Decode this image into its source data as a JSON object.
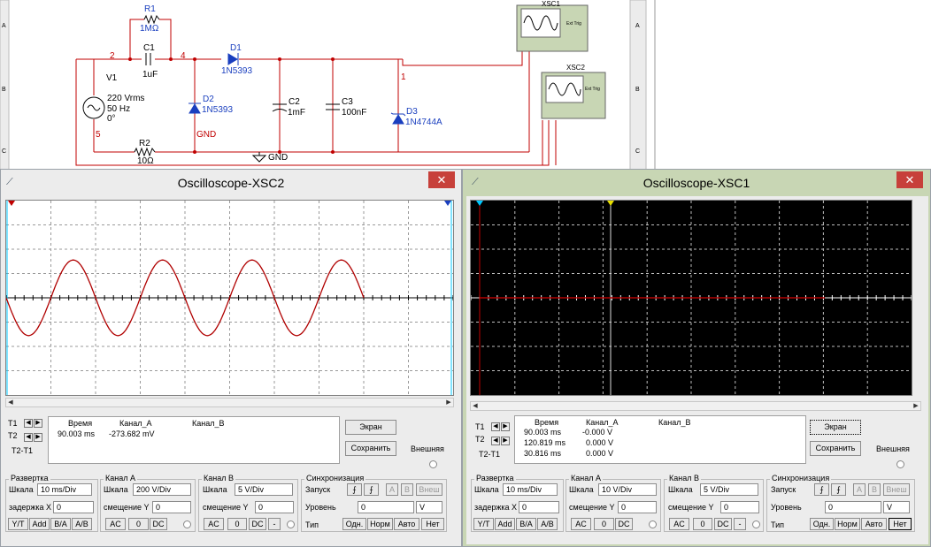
{
  "schematic": {
    "row_labels": [
      "A",
      "B",
      "C"
    ],
    "r1": {
      "name": "R1",
      "value": "1MΩ"
    },
    "c1": {
      "name": "C1",
      "value": "1uF"
    },
    "d1": {
      "name": "D1",
      "value": "1N5393"
    },
    "v1": {
      "name": "V1",
      "line1": "220 Vrms",
      "line2": "50 Hz",
      "line3": "0°"
    },
    "d2": {
      "name": "D2",
      "value": "1N5393"
    },
    "c2": {
      "name": "C2",
      "value": "1mF"
    },
    "c3": {
      "name": "C3",
      "value": "100nF"
    },
    "d3": {
      "name": "D3",
      "value": "1N4744A"
    },
    "r2": {
      "name": "R2",
      "value": "10Ω"
    },
    "gnd1": "GND",
    "gnd2": "GND",
    "nodes": {
      "n2": "2",
      "n4": "4",
      "n1": "1",
      "n5": "5"
    },
    "xsc1": {
      "name": "XSC1",
      "ext": "Ext Trig"
    },
    "xsc2": {
      "name": "XSC2",
      "ext": "Ext Trig"
    }
  },
  "xsc2_window": {
    "title": "Oscilloscope-XSC2",
    "close": "✕",
    "readout": {
      "col_time": "Время",
      "col_a": "Канал_A",
      "col_b": "Канал_B",
      "rows": [
        {
          "t": "T1"
        },
        {
          "t": "T2"
        },
        {
          "t": "T2-T1"
        }
      ],
      "values": [
        {
          "time": "90.003 ms",
          "a": "-273.682 mV",
          "b": ""
        }
      ]
    },
    "btn_screen": "Экран",
    "btn_save": "Сохранить",
    "external": "Внешняя",
    "timebase": {
      "title": "Развертка",
      "scale_label": "Шкала",
      "scale": "10 ms/Div",
      "delay_label": "задержка X",
      "delay": "0",
      "btns": [
        "Y/T",
        "Add",
        "B/A",
        "A/B"
      ]
    },
    "channel_a": {
      "title": "Канал А",
      "scale_label": "Шкала",
      "scale": "200  V/Div",
      "offset_label": "смещение Y",
      "offset": "0",
      "btns": [
        "AC",
        "0",
        "DC"
      ]
    },
    "channel_b": {
      "title": "Канал В",
      "scale_label": "Шкала",
      "scale": "5  V/Div",
      "offset_label": "смещение Y",
      "offset": "0",
      "btns": [
        "AC",
        "0",
        "DC",
        "-"
      ]
    },
    "trigger": {
      "title": "Синхронизация",
      "start_label": "Запуск",
      "edge_btns": [
        "⨍",
        "⨍",
        "A",
        "B",
        "Внеш"
      ],
      "level_label": "Уровень",
      "level": "0",
      "level_unit": "V",
      "type_label": "Тип",
      "type_btns": [
        "Одн.",
        "Норм",
        "Авто",
        "Нет"
      ]
    }
  },
  "xsc1_window": {
    "title": "Oscilloscope-XSC1",
    "close": "✕",
    "readout": {
      "col_time": "Время",
      "col_a": "Канал_A",
      "col_b": "Канал_B",
      "rows": [
        {
          "t": "T1"
        },
        {
          "t": "T2"
        },
        {
          "t": "T2-T1"
        }
      ],
      "values": [
        {
          "time": "90.003 ms",
          "a": "-0.000 V",
          "b": ""
        },
        {
          "time": "120.819 ms",
          "a": "0.000 V",
          "b": ""
        },
        {
          "time": "30.816 ms",
          "a": "0.000 V",
          "b": ""
        }
      ]
    },
    "btn_screen": "Экран",
    "btn_save": "Сохранить",
    "external": "Внешняя",
    "timebase": {
      "title": "Развертка",
      "scale_label": "Шкала",
      "scale": "10 ms/Div",
      "delay_label": "задержка X",
      "delay": "0",
      "btns": [
        "Y/T",
        "Add",
        "B/A",
        "A/B"
      ]
    },
    "channel_a": {
      "title": "Канал А",
      "scale_label": "Шкала",
      "scale": "10  V/Div",
      "offset_label": "смещение Y",
      "offset": "0",
      "btns": [
        "AC",
        "0",
        "DC"
      ]
    },
    "channel_b": {
      "title": "Канал В",
      "scale_label": "Шкала",
      "scale": "5  V/Div",
      "offset_label": "смещение Y",
      "offset": "0",
      "btns": [
        "AC",
        "0",
        "DC",
        "-"
      ]
    },
    "trigger": {
      "title": "Синхронизация",
      "start_label": "Запуск",
      "edge_btns": [
        "⨍",
        "⨍",
        "A",
        "B",
        "Внеш"
      ],
      "level_label": "Уровень",
      "level": "0",
      "level_unit": "V",
      "type_label": "Тип",
      "type_btns": [
        "Одн.",
        "Норм",
        "Авто",
        "Нет"
      ]
    }
  },
  "colors": {
    "trace": "#b00000",
    "xsc1_frame": "#c8d6b4",
    "xsc2_frame": "#ececec",
    "close": "#c7403a",
    "cursor1": "#00c8ff",
    "cursor2": "#e8e000"
  }
}
